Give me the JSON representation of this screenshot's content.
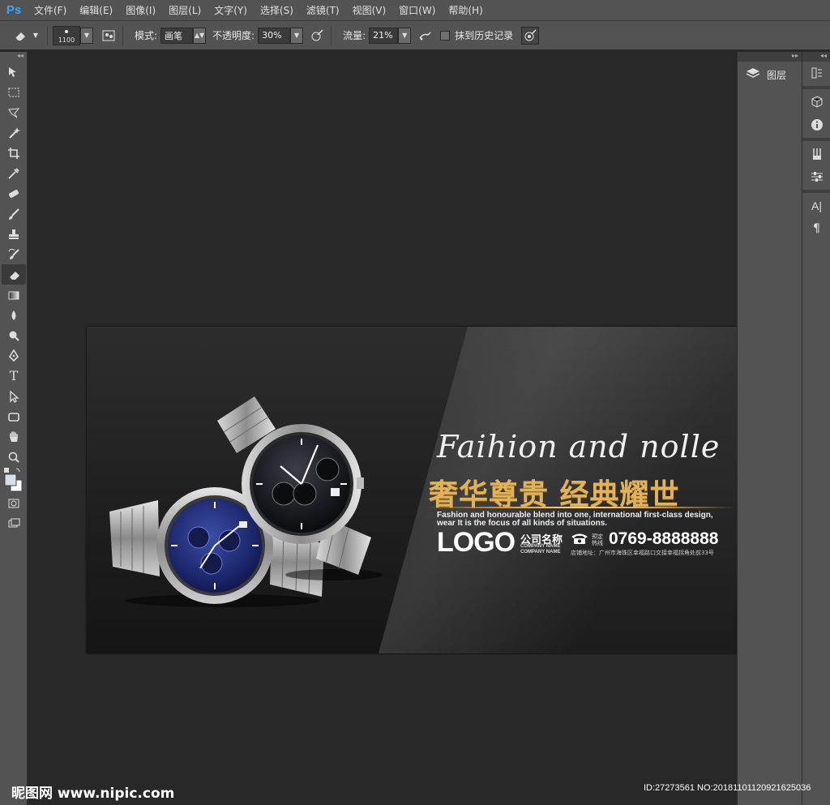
{
  "app": {
    "logo": "Ps"
  },
  "menu": [
    "文件(F)",
    "编辑(E)",
    "图像(I)",
    "图层(L)",
    "文字(Y)",
    "选择(S)",
    "滤镜(T)",
    "视图(V)",
    "窗口(W)",
    "帮助(H)"
  ],
  "options": {
    "brush_size": "1100",
    "mode_label": "模式:",
    "mode_value": "画笔",
    "opacity_label": "不透明度:",
    "opacity_value": "30%",
    "flow_label": "流量:",
    "flow_value": "21%",
    "history_label": "抹到历史记录"
  },
  "panels": {
    "layers_label": "图层"
  },
  "design": {
    "script_title": "Faihion and nolle",
    "gold_title": "奢华尊贵 经典耀世",
    "english_text": "Fashion and honourable blend into one, international first-class design, wear It is the focus of all kinds of situations.",
    "logo": "LOGO",
    "company_name": "公司名称",
    "company_sub_1": "COMPANY NAME",
    "company_sub_2": "COMPANY NAME",
    "phone_label_1": "预定",
    "phone_label_2": "热线",
    "phone": "0769-8888888",
    "address": "店铺地址：广州市海珠区幸福路口交接幸福拐角处前33号"
  },
  "watermark": {
    "left": "昵图网 www.nipic.com",
    "right": "ID:27273561 NO:20181101120921625036"
  },
  "colors": {
    "accent_blue": "#31a8ff",
    "gold": "#e2b356",
    "ui_gray": "#535353",
    "canvas_bg": "#282828"
  }
}
